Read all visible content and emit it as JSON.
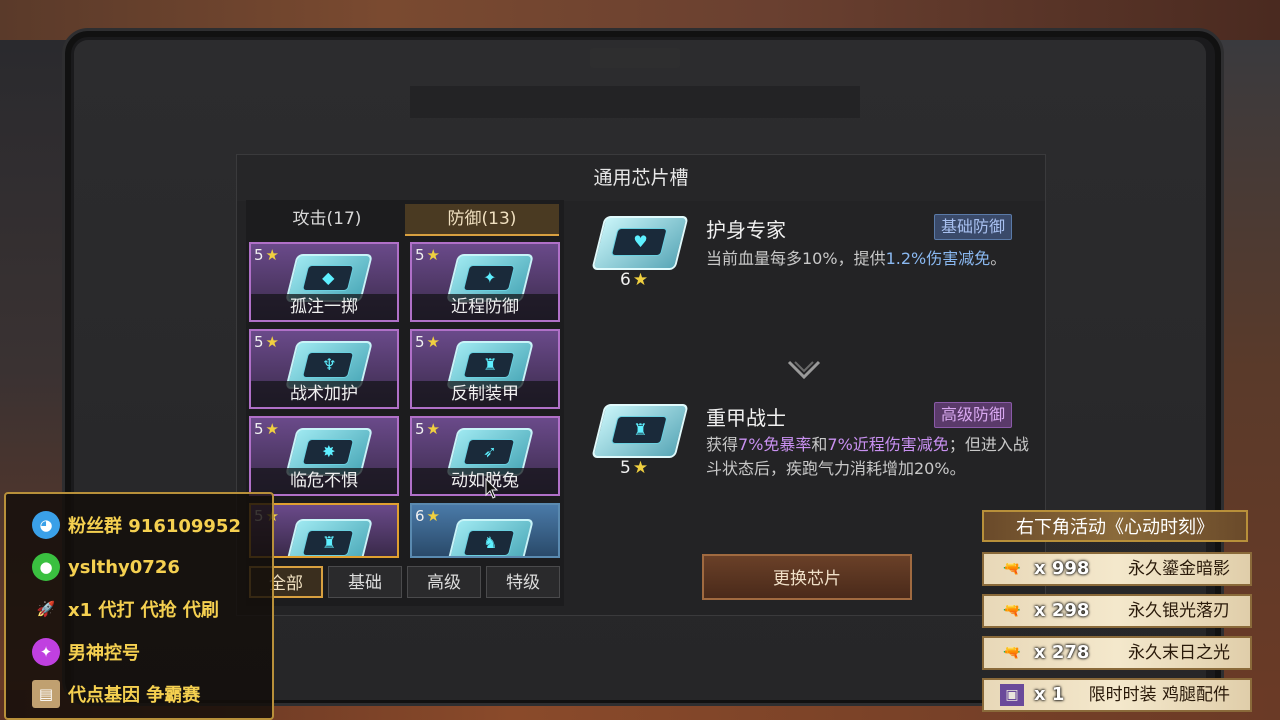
{
  "dialog": {
    "title": "通用芯片槽"
  },
  "tabs": {
    "attack": "攻击(17)",
    "defense": "防御(13)"
  },
  "cards": [
    {
      "stars": "5",
      "name": "孤注一掷",
      "glyph": "◆"
    },
    {
      "stars": "5",
      "name": "近程防御",
      "glyph": "✦"
    },
    {
      "stars": "5",
      "name": "战术加护",
      "glyph": "♆"
    },
    {
      "stars": "5",
      "name": "反制装甲",
      "glyph": "♜"
    },
    {
      "stars": "5",
      "name": "临危不惧",
      "glyph": "✸"
    },
    {
      "stars": "5",
      "name": "动如脱兔",
      "glyph": "➶"
    },
    {
      "stars": "5",
      "name": "",
      "glyph": "♜"
    },
    {
      "stars": "6",
      "name": "",
      "glyph": "♞"
    }
  ],
  "filters": [
    "全部",
    "基础",
    "高级",
    "特级"
  ],
  "current_chip": {
    "name": "护身专家",
    "tier": "基础防御",
    "stars": "6",
    "desc_pre": "当前血量每多10%，提供",
    "desc_hl": "1.2%伤害减免",
    "desc_post": "。"
  },
  "new_chip": {
    "name": "重甲战士",
    "tier": "高级防御",
    "stars": "5",
    "desc_pre": "获得",
    "desc_hl1": "7%免暴率",
    "desc_mid": "和",
    "desc_hl2": "7%近程伤害减免",
    "desc_post": "；但进入战斗状态后，疾跑气力消耗增加20%。"
  },
  "replace_button": "更换芯片",
  "streamer": {
    "rows": [
      {
        "icon": "qq-icon",
        "text": "粉丝群 916109952"
      },
      {
        "icon": "wechat-icon",
        "text": "yslthy0726"
      },
      {
        "icon": "rocket-icon",
        "text": "x1 代打 代抢 代刷"
      },
      {
        "icon": "controller-icon",
        "text": "男神控号"
      },
      {
        "icon": "gene-icon",
        "text": "代点基因 争霸赛"
      }
    ]
  },
  "event": {
    "title": "右下角活动《心动时刻》",
    "rewards": [
      {
        "count": "x 998",
        "name": "永久鎏金暗影"
      },
      {
        "count": "x 298",
        "name": "永久银光落刃"
      },
      {
        "count": "x 278",
        "name": "永久末日之光"
      },
      {
        "count": "x 1",
        "name": "限时时装 鸡腿配件"
      }
    ]
  },
  "colors": {
    "accent_gold": "#d8a040",
    "basic_tier": "#a8c0f0",
    "advanced_tier": "#d8a8f0",
    "highlight_blue": "#8ab8f0",
    "highlight_purple": "#c890f0",
    "streamer_text": "#f5d050"
  }
}
